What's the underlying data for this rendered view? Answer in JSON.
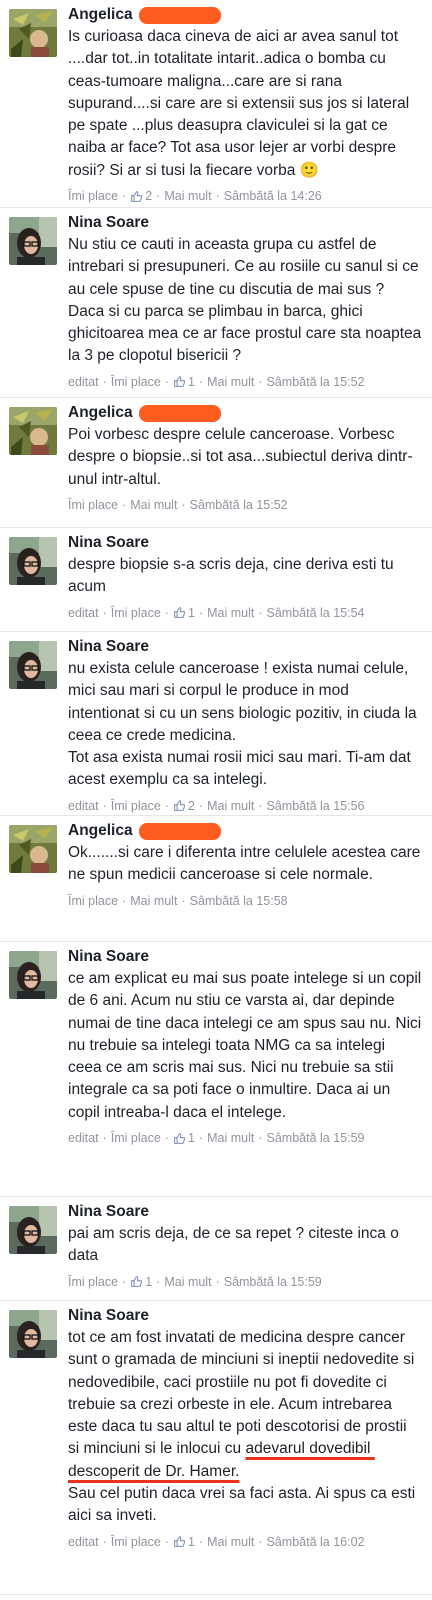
{
  "comments": [
    {
      "author": "Angelica",
      "redacted": true,
      "avatar": "angelica",
      "height": 208,
      "text_parts": [
        "Is curioasa daca cineva de aici ar avea sanul tot ....dar tot..in totalitate intarit..adica o bomba cu ceas-tumoare maligna...care are si rana supurand....si care are si extensii sus jos si lateral pe spate ...plus deasupra claviculei si la gat ce naiba ar face? Tot asa usor lejer ar vorbi despre rosii? Si ar si tusi la fiecare vorba 🙂"
      ],
      "edited": "",
      "like_label": "Îmi place",
      "reactions": "2",
      "more_label": "Mai mult",
      "timestamp": "Sâmbătă la 14:26"
    },
    {
      "author": "Nina Soare",
      "redacted": false,
      "avatar": "nina",
      "height": 190,
      "text_parts": [
        "Nu stiu ce cauti in aceasta grupa cu astfel de intrebari si presupuneri. Ce au rosiile cu sanul si ce au cele spuse de tine cu discutia de mai sus ? Daca si cu parca se plimbau in barca, ghici ghicitoarea mea ce ar face prostul care sta noaptea la 3 pe clopotul bisericii ?"
      ],
      "edited": "editat",
      "like_label": "Îmi place",
      "reactions": "1",
      "more_label": "Mai mult",
      "timestamp": "Sâmbătă la 15:52"
    },
    {
      "author": "Angelica",
      "redacted": true,
      "avatar": "angelica",
      "height": 130,
      "text_parts": [
        "Poi vorbesc despre celule canceroase. Vorbesc despre o biopsie..si tot asa...subiectul deriva dintr-unul intr-altul."
      ],
      "edited": "",
      "like_label": "Îmi place",
      "reactions": "",
      "more_label": "Mai mult",
      "timestamp": "Sâmbătă la 15:52"
    },
    {
      "author": "Nina Soare",
      "redacted": false,
      "avatar": "nina",
      "height": 104,
      "text_parts": [
        "despre biopsie s-a scris deja, cine deriva esti tu acum"
      ],
      "edited": "editat",
      "like_label": "Îmi place",
      "reactions": "1",
      "more_label": "Mai mult",
      "timestamp": "Sâmbătă la 15:54"
    },
    {
      "author": "Nina Soare",
      "redacted": false,
      "avatar": "nina",
      "height": 184,
      "text_parts": [
        "nu exista celule canceroase ! exista numai celule, mici sau mari si corpul le produce in mod intentionat si cu un sens biologic pozitiv, in ciuda la ceea ce crede medicina.\nTot asa exista numai rosii mici sau mari. Ti-am dat acest exemplu ca sa intelegi."
      ],
      "edited": "editat",
      "like_label": "Îmi place",
      "reactions": "2",
      "more_label": "Mai mult",
      "timestamp": "Sâmbătă la 15:56"
    },
    {
      "author": "Angelica",
      "redacted": true,
      "avatar": "angelica",
      "height": 126,
      "text_parts": [
        "Ok.......si care i diferenta intre celulele acestea care ne spun medicii canceroase si cele normale."
      ],
      "edited": "",
      "like_label": "Îmi place",
      "reactions": "",
      "more_label": "Mai mult",
      "timestamp": "Sâmbătă la 15:58"
    },
    {
      "author": "Nina Soare",
      "redacted": false,
      "avatar": "nina",
      "height": 255,
      "text_parts": [
        "ce am explicat eu mai sus poate intelege si un copil de 6 ani. Acum nu stiu ce varsta ai, dar depinde numai de tine daca intelegi ce am spus sau nu. Nici nu trebuie sa intelegi toata NMG ca sa intelegi ceea ce am scris mai sus. Nici nu trebuie sa stii integrale ca sa poti face o inmultire. Daca ai un copil intreaba-l daca el intelege."
      ],
      "edited": "editat",
      "like_label": "Îmi place",
      "reactions": "1",
      "more_label": "Mai mult",
      "timestamp": "Sâmbătă la 15:59"
    },
    {
      "author": "Nina Soare",
      "redacted": false,
      "avatar": "nina",
      "height": 104,
      "text_parts": [
        "pai am scris deja, de ce sa repet ? citeste inca o data"
      ],
      "edited": "",
      "like_label": "Îmi place",
      "reactions": "1",
      "more_label": "Mai mult",
      "timestamp": "Sâmbătă la 15:59"
    },
    {
      "author": "Nina Soare",
      "redacted": false,
      "avatar": "nina",
      "height": 294,
      "text_parts": [
        "tot ce am fost invatati de medicina despre cancer sunt o gramada de minciuni si ineptii nedovedite si nedovedibile, caci prostiile nu pot fi dovedite ci trebuie sa crezi orbeste in ele. Acum intrebarea este daca tu sau altul te poti descotorisi de prostii si minciuni si le inlocui cu ",
        "adevarul dovedibil descoperit de Dr. Hamer.",
        "\nSau cel putin daca vrei sa faci asta. Ai spus ca esti aici sa inveti."
      ],
      "edited": "editat",
      "like_label": "Îmi place",
      "reactions": "1",
      "more_label": "Mai mult",
      "timestamp": "Sâmbătă la 16:02"
    }
  ]
}
